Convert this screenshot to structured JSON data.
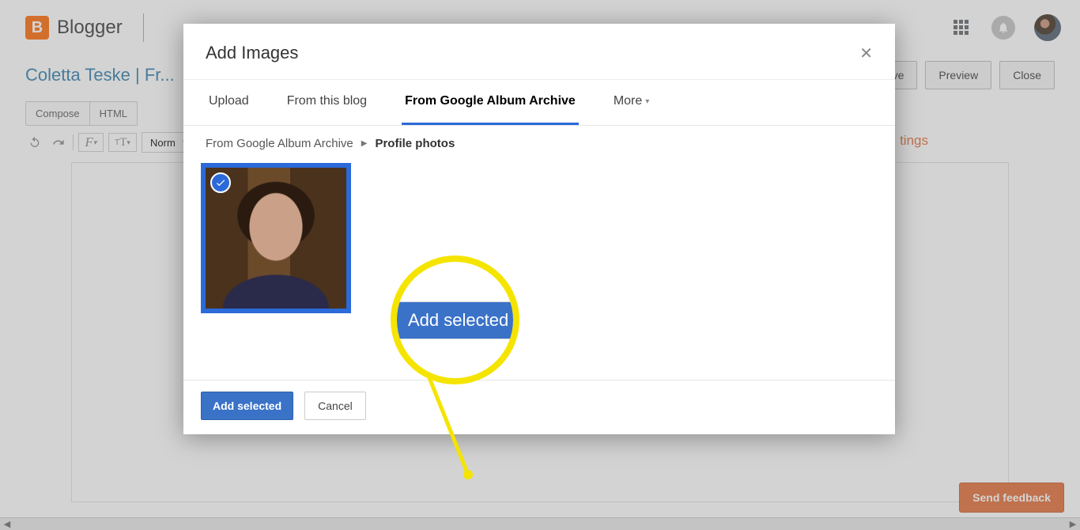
{
  "header": {
    "logo_letter": "B",
    "logo_text": "Blogger"
  },
  "row2": {
    "title": "Coletta Teske | Fr...",
    "save_suffix": "ve",
    "preview": "Preview",
    "close": "Close",
    "settings_suffix": "tings"
  },
  "toolbar": {
    "compose": "Compose",
    "html": "HTML",
    "font_placeholder": "Norm"
  },
  "modal": {
    "title": "Add Images",
    "tabs": {
      "upload": "Upload",
      "from_blog": "From this blog",
      "from_archive": "From Google Album Archive",
      "more": "More"
    },
    "breadcrumb": {
      "root": "From Google Album Archive",
      "leaf": "Profile photos"
    },
    "footer": {
      "add_selected": "Add selected",
      "cancel": "Cancel"
    }
  },
  "callout": {
    "label": "Add selected"
  },
  "feedback": "Send feedback"
}
